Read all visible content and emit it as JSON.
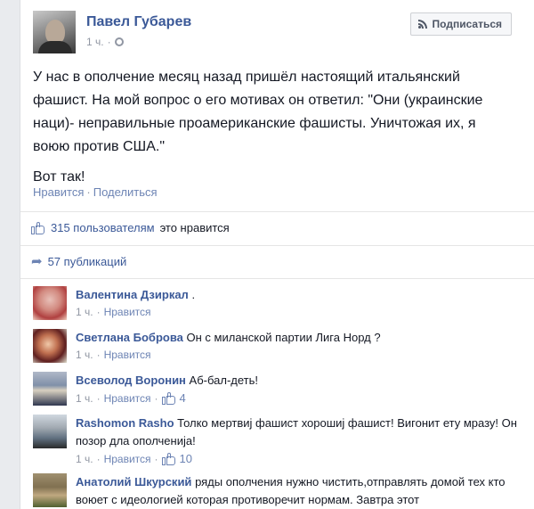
{
  "post": {
    "author": "Павел Губарев",
    "time": "1 ч.",
    "subscribe_label": "Подписаться",
    "paragraphs": [
      "У нас в ополчение месяц назад пришёл настоящий итальянский фашист. На мой вопрос о его мотивах он ответил: \"Они (украинские наци)- неправильные проамериканские фашисты. Уничтожая их, я воюю против США.\"",
      "Вот так!"
    ],
    "like_action": "Нравится",
    "separator": "·",
    "share_action": "Поделиться"
  },
  "ufi": {
    "likes_link": "315 пользователям",
    "likes_suffix": "это нравится",
    "shares": "57 публикаций"
  },
  "comments": [
    {
      "name": "Валентина Дзиркал",
      "text": ".",
      "time": "1 ч.",
      "like": "Нравится",
      "count": ""
    },
    {
      "name": "Светлана Боброва",
      "text": "Он с миланской партии Лига Норд ?",
      "time": "1 ч.",
      "like": "Нравится",
      "count": ""
    },
    {
      "name": "Всеволод Воронин",
      "text": "Аб-бал-деть!",
      "time": "1 ч.",
      "like": "Нравится",
      "count": "4"
    },
    {
      "name": "Rashomon Rasho",
      "text": "Толко мертвиј фашист хорошиј фашист! Вигонит ету мразу! Он позор дла ополченија!",
      "time": "1 ч.",
      "like": "Нравится",
      "count": "10"
    },
    {
      "name": "Анатолий Шкурский",
      "text": "ряды ополчения нужно чистить,отправлять домой тех кто воюет с идеологией которая противоречит нормам. Завтра этот",
      "time": "",
      "like": "",
      "count": ""
    }
  ],
  "colors": {
    "link": "#3b5998",
    "muted": "#9197a3",
    "action": "#6d84b4"
  }
}
